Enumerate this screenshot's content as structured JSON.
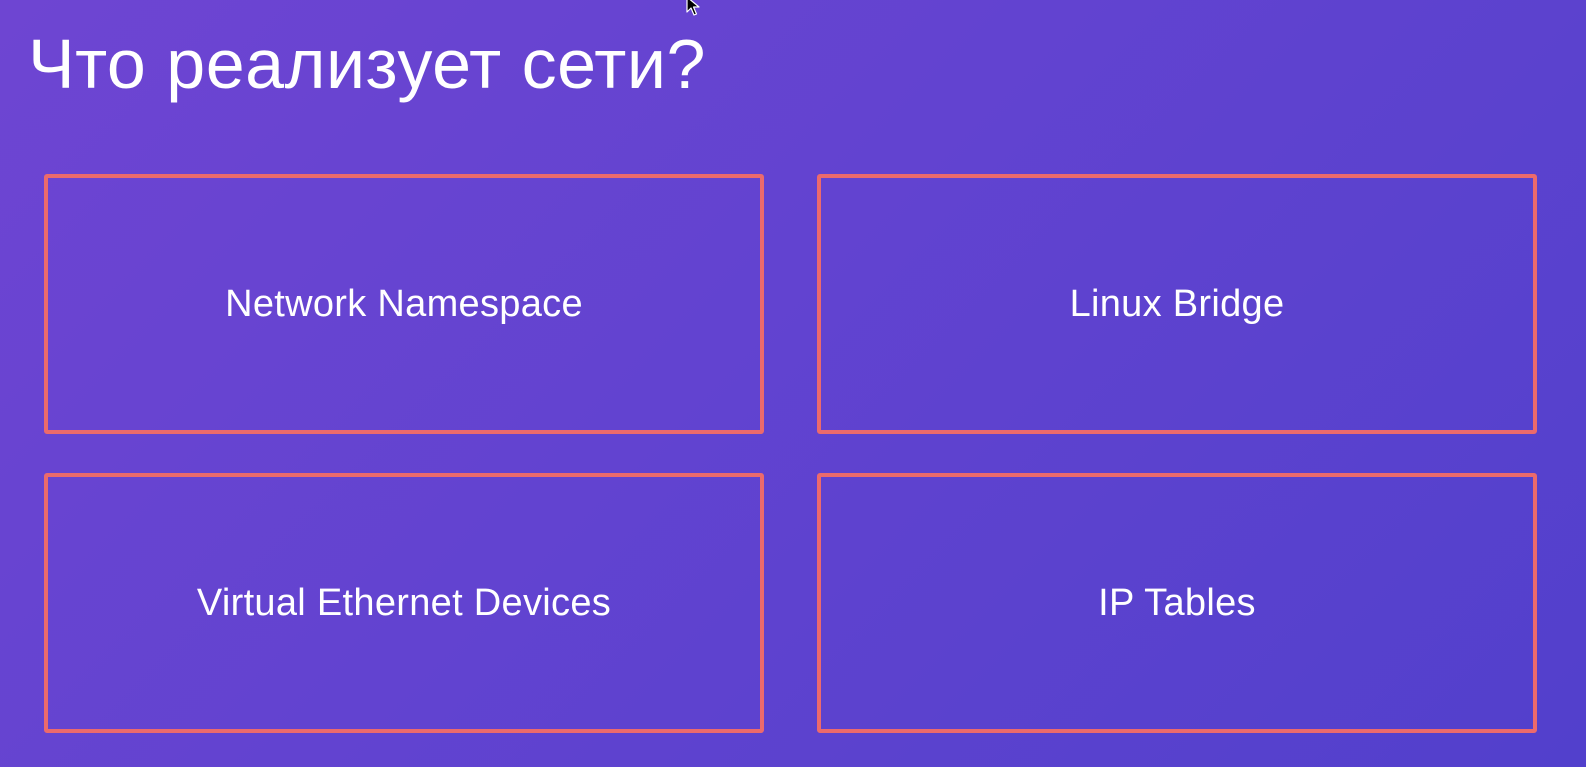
{
  "slide": {
    "title": "Что реализует сети?",
    "cards": [
      {
        "label": "Network Namespace"
      },
      {
        "label": "Linux Bridge"
      },
      {
        "label": "Virtual Ethernet Devices"
      },
      {
        "label": "IP Tables"
      }
    ]
  },
  "colors": {
    "background_start": "#6e45d2",
    "background_end": "#5240cc",
    "card_border": "#ec6a6c",
    "text": "#ffffff"
  },
  "icons": {
    "cursor": "mouse-pointer-icon"
  }
}
